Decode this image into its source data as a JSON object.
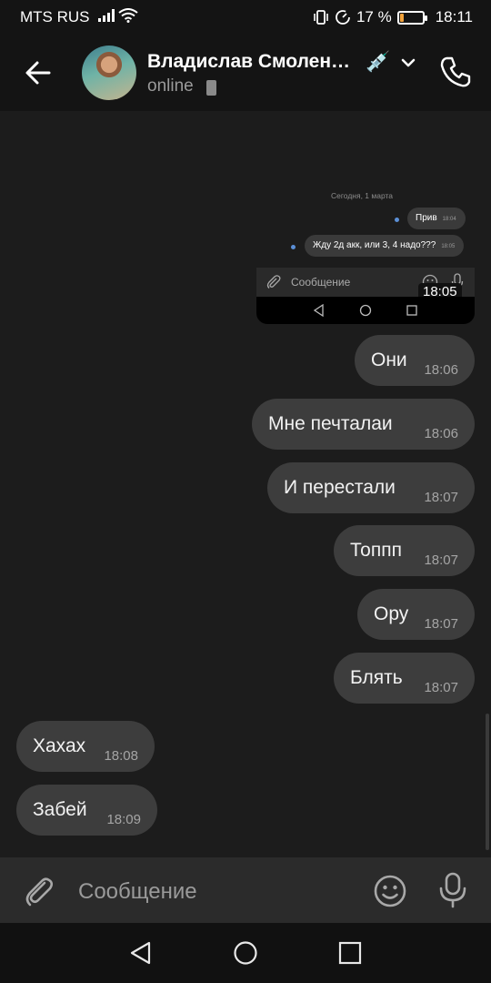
{
  "status_bar": {
    "carrier": "MTS RUS",
    "battery_percent": "17 %",
    "battery_level": 0.17,
    "time": "18:11"
  },
  "header": {
    "contact_name": "Владислав Смолен…",
    "name_emoji": "💉",
    "status": "online"
  },
  "embedded_screenshot": {
    "date": "Сегодня, 1 марта",
    "messages": [
      {
        "text": "Прив",
        "time": "18:04"
      },
      {
        "text": "Жду 2д акк, или 3, 4 надо???",
        "time": "18:05"
      }
    ],
    "input_placeholder": "Сообщение",
    "time": "18:05"
  },
  "messages": [
    {
      "text": "Они",
      "time": "18:06",
      "side": "out"
    },
    {
      "text": "Мне печталаи",
      "time": "18:06",
      "side": "out"
    },
    {
      "text": "И перестали",
      "time": "18:07",
      "side": "out"
    },
    {
      "text": "Топпп",
      "time": "18:07",
      "side": "out"
    },
    {
      "text": "Ору",
      "time": "18:07",
      "side": "out"
    },
    {
      "text": "Блять",
      "time": "18:07",
      "side": "out"
    },
    {
      "text": "Хахах",
      "time": "18:08",
      "side": "in"
    },
    {
      "text": "Забей",
      "time": "18:09",
      "side": "in"
    }
  ],
  "composer": {
    "placeholder": "Сообщение"
  },
  "icons": {
    "back": "arrow-left-icon",
    "call": "phone-icon",
    "attach": "paperclip-icon",
    "emoji": "smile-icon",
    "voice": "microphone-icon"
  },
  "colors": {
    "background": "#1c1c1c",
    "header": "#141414",
    "bubble": "#3d3d3d",
    "battery_low": "#f2a23b"
  }
}
